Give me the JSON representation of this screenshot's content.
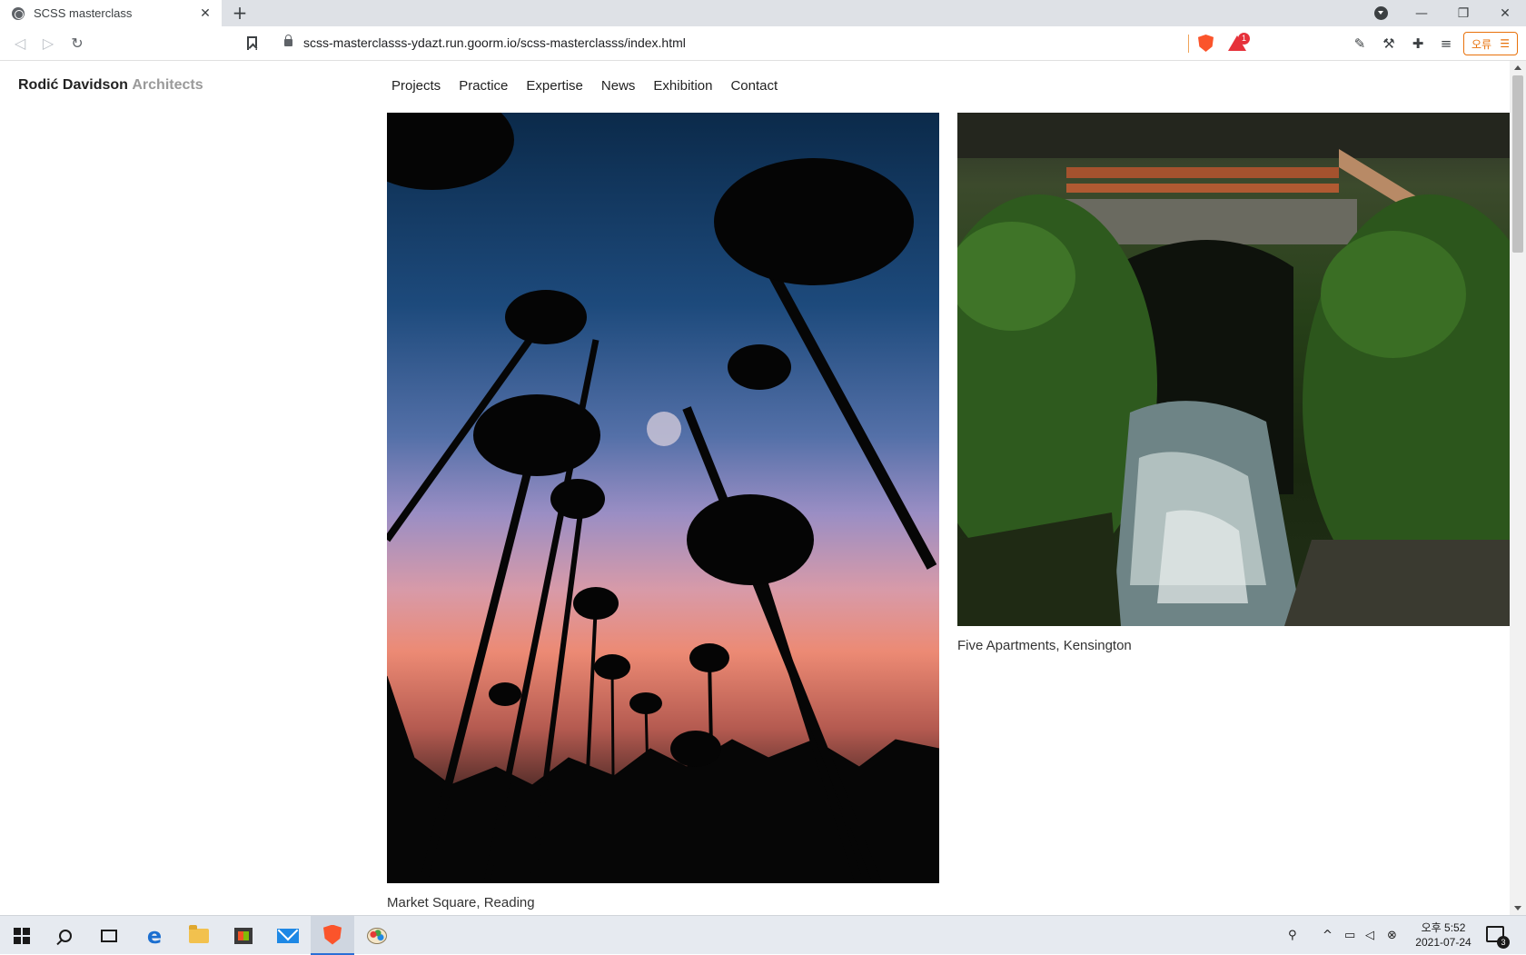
{
  "browser": {
    "tab_title": "SCSS masterclass",
    "tab_close": "✕",
    "new_tab": "+",
    "url": "scss-masterclasss-ydazt.run.goorm.io/scss-masterclasss/index.html",
    "rewards_badge": "1",
    "error_button_label": "오류",
    "window_controls": {
      "minimize": "—",
      "restore": "❐",
      "close": "✕"
    },
    "toolbar_glyphs": {
      "back": "◁",
      "forward": "▷",
      "reload": "↻",
      "menu": "☰"
    }
  },
  "site": {
    "brand_name": "Rodić Davidson",
    "brand_sub": "Architects",
    "nav": [
      "Projects",
      "Practice",
      "Expertise",
      "News",
      "Exhibition",
      "Contact"
    ]
  },
  "projects": [
    {
      "caption": "Market Square, Reading",
      "image": "palm-trees-sunset-photo"
    },
    {
      "caption": "Five Apartments, Kensington",
      "image": "stone-bridge-creek-photo"
    }
  ],
  "taskbar": {
    "clock_time": "오후 5:52",
    "clock_date": "2021-07-24",
    "notification_count": "3",
    "edge_glyph": "e"
  }
}
